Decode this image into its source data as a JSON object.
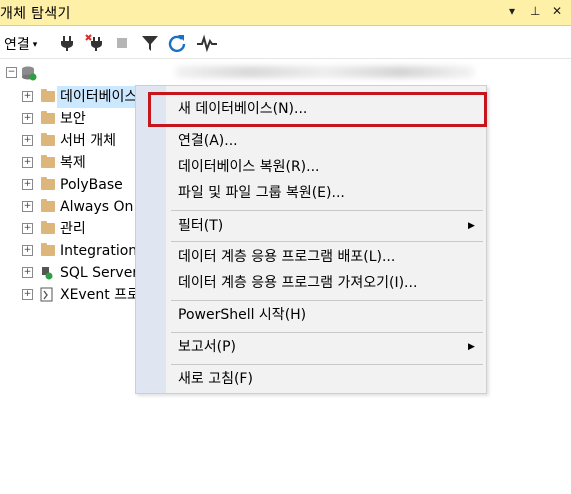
{
  "window": {
    "title": "개체 탐색기",
    "controls": {
      "dropdown": "▾",
      "pin": "⊥",
      "close": "✕"
    }
  },
  "toolbar": {
    "connect_label": "연결",
    "connect_arrow": "▾",
    "icons": [
      "connect-plug-icon",
      "disconnect-plug-icon",
      "stop-icon",
      "filter-icon",
      "refresh-icon",
      "activity-monitor-icon"
    ]
  },
  "tree": {
    "root_expander": "−",
    "items": [
      {
        "label": "데이터베이스",
        "icon": "folder-icon"
      },
      {
        "label": "보안",
        "icon": "folder-icon"
      },
      {
        "label": "서버 개체",
        "icon": "folder-icon"
      },
      {
        "label": "복제",
        "icon": "folder-icon"
      },
      {
        "label": "PolyBase",
        "icon": "folder-icon"
      },
      {
        "label": "Always On",
        "icon": "folder-icon"
      },
      {
        "label": "관리",
        "icon": "folder-icon"
      },
      {
        "label": "Integration",
        "icon": "folder-icon"
      },
      {
        "label": "SQL Server",
        "icon": "sql-agent-icon"
      },
      {
        "label": "XEvent 프로",
        "icon": "xevent-icon"
      }
    ],
    "expander_symbol": "+"
  },
  "context_menu": {
    "items": [
      {
        "label": "새 데이터베이스(N)...",
        "highlighted": true
      },
      {
        "label": "연결(A)..."
      },
      {
        "label": "데이터베이스 복원(R)..."
      },
      {
        "label": "파일 및 파일 그룹 복원(E)..."
      },
      {
        "label": "필터(T)",
        "submenu": true
      },
      {
        "label": "데이터 계층 응용 프로그램 배포(L)..."
      },
      {
        "label": "데이터 계층 응용 프로그램 가져오기(I)..."
      },
      {
        "label": "PowerShell 시작(H)"
      },
      {
        "label": "보고서(P)",
        "submenu": true
      },
      {
        "label": "새로 고침(F)"
      }
    ],
    "submenu_arrow": "▶",
    "highlight_color": "#c4161c"
  }
}
